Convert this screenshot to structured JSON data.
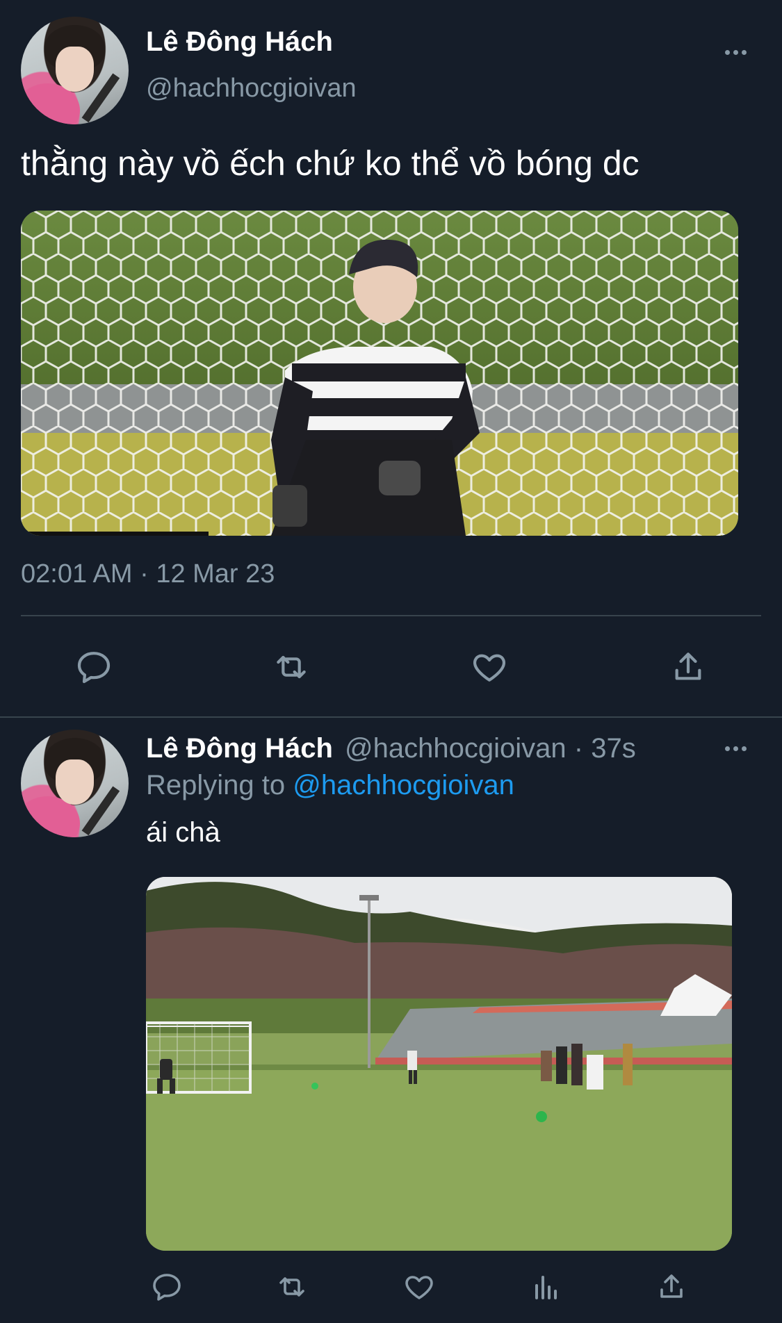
{
  "main_tweet": {
    "display_name": "Lê Đông Hách",
    "handle": "@hachhocgioivan",
    "text": "thằng này vồ ếch chứ ko thể vồ bóng dc",
    "timestamp": "02:01 AM · 12 Mar 23",
    "media_icon": "goalkeeper-photo"
  },
  "reply_tweet": {
    "display_name": "Lê Đông Hách",
    "handle": "@hachhocgioivan",
    "separator": "·",
    "time_ago": "37s",
    "replying_to_prefix": "Replying to",
    "replying_to_handle": "@hachhocgioivan",
    "text": "ái chà",
    "media_icon": "soccer-field-photo"
  },
  "icons": {
    "reply": "reply-icon",
    "retweet": "retweet-icon",
    "like": "heart-icon",
    "share": "share-icon",
    "analytics": "analytics-icon",
    "more": "more-icon"
  },
  "colors": {
    "background": "#151d29",
    "muted": "#8899a6",
    "link": "#1d9bf0",
    "divider": "#38444d"
  }
}
